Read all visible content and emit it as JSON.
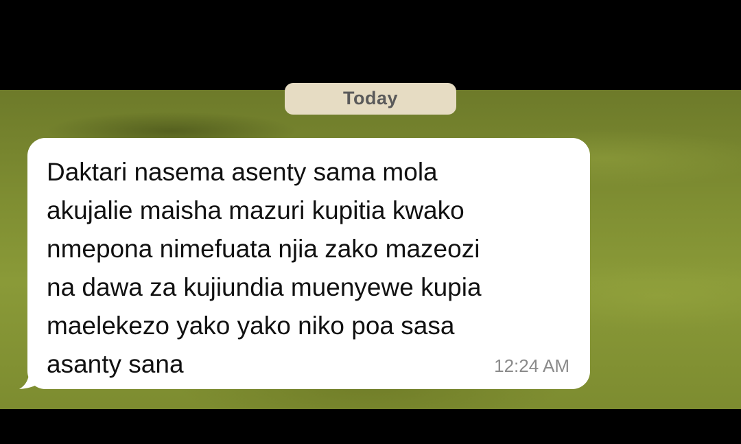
{
  "chat": {
    "date_label": "Today",
    "message": {
      "text": "Daktari nasema asenty sama mola\nakujalie maisha mazuri kupitia kwako\nnmepona nimefuata njia zako mazeozi\nna dawa za kujiundia muenyewe kupia\nmaelekezo yako yako niko poa sasa\nasanty sana",
      "time": "12:24 AM",
      "direction": "incoming"
    }
  },
  "colors": {
    "bubble": "#ffffff",
    "date_chip": "#e6dcc3",
    "wallpaper": "#7f8e32",
    "timestamp": "#8a8a8a"
  }
}
